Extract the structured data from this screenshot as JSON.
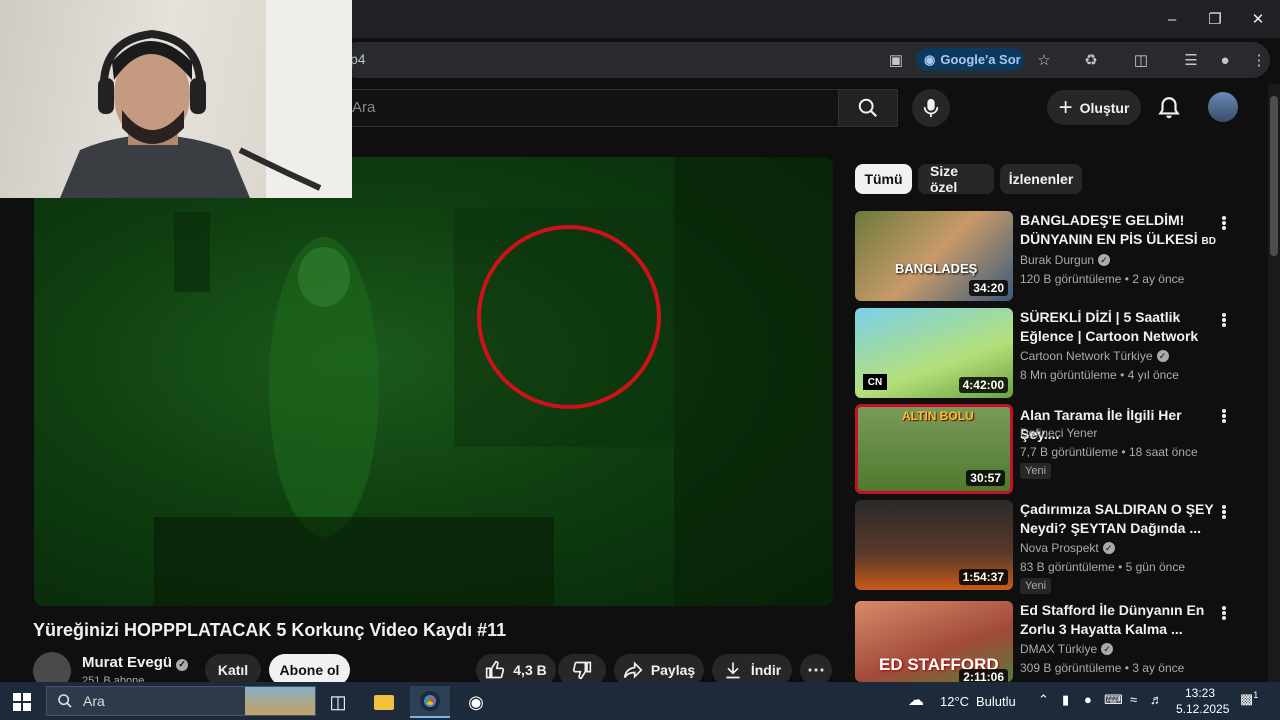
{
  "browser": {
    "address_fragment": "p4",
    "ask_google_label": "Google'a Sor"
  },
  "youtube": {
    "search_placeholder": "Ara",
    "create_label": "Oluştur"
  },
  "video": {
    "title": "Yüreğinizi HOPPPLATACAK 5 Korkunç Video Kaydı #11",
    "channel": "Murat Evegü",
    "subscribers": "251 B abone",
    "join_label": "Katıl",
    "subscribe_label": "Abone ol",
    "likes": "4,3 B",
    "share_label": "Paylaş",
    "download_label": "İndir"
  },
  "chips": [
    "Tümü",
    "Size özel",
    "İzlenenler"
  ],
  "recommendations": [
    {
      "title": "BANGLADEŞ'E GELDİM! DÜNYANIN EN PİS ÜLKESİ",
      "title_suffix": "BD",
      "channel": "Burak Durgun",
      "verified": true,
      "views": "120 B görüntüleme",
      "age": "2 ay önce",
      "duration": "34:20",
      "thumb_text": "BANGLADEŞ",
      "is_new": false
    },
    {
      "title": "SÜREKLİ DİZİ | 5 Saatlik Eğlence | Cartoon Network Türkiye",
      "channel": "Cartoon Network Türkiye",
      "verified": true,
      "views": "8 Mn görüntüleme",
      "age": "4 yıl önce",
      "duration": "4:42:00",
      "thumb_text": "CN",
      "is_new": false
    },
    {
      "title": "Alan Tarama İle İlgili Her Şey....",
      "channel": "Defineci Yener",
      "verified": false,
      "views": "7,7 B görüntüleme",
      "age": "18 saat önce",
      "duration": "30:57",
      "thumb_text": "ALTIN BOLU",
      "is_new": true,
      "new_label": "Yeni"
    },
    {
      "title": "Çadırımıza SALDIRAN O ŞEY Neydi? ŞEYTAN Dağında ...",
      "channel": "Nova Prospekt",
      "verified": true,
      "views": "83 B görüntüleme",
      "age": "5 gün önce",
      "duration": "1:54:37",
      "thumb_text": "",
      "is_new": true,
      "new_label": "Yeni"
    },
    {
      "title": "Ed Stafford İle Dünyanın En Zorlu 3 Hayatta Kalma ...",
      "channel": "DMAX Türkiye",
      "verified": true,
      "views": "309 B görüntüleme",
      "age": "3 ay önce",
      "duration": "2:11:06",
      "thumb_text": "ED STAFFORD",
      "is_new": false
    }
  ],
  "taskbar": {
    "search_label": "Ara",
    "weather": "12°C",
    "weather_desc": "Bulutlu",
    "time": "13:23",
    "date": "5.12.2025",
    "notif_count": "1"
  }
}
